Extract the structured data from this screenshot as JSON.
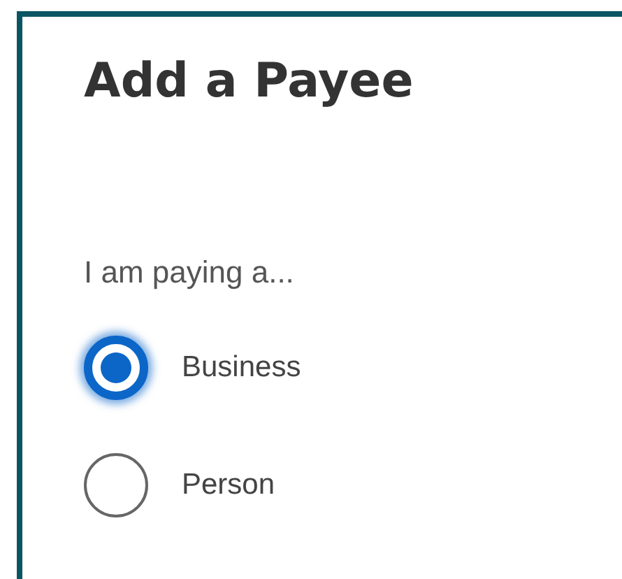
{
  "title": "Add a Payee",
  "question": "I am paying a...",
  "options": [
    {
      "label": "Business",
      "selected": true
    },
    {
      "label": "Person",
      "selected": false
    }
  ]
}
